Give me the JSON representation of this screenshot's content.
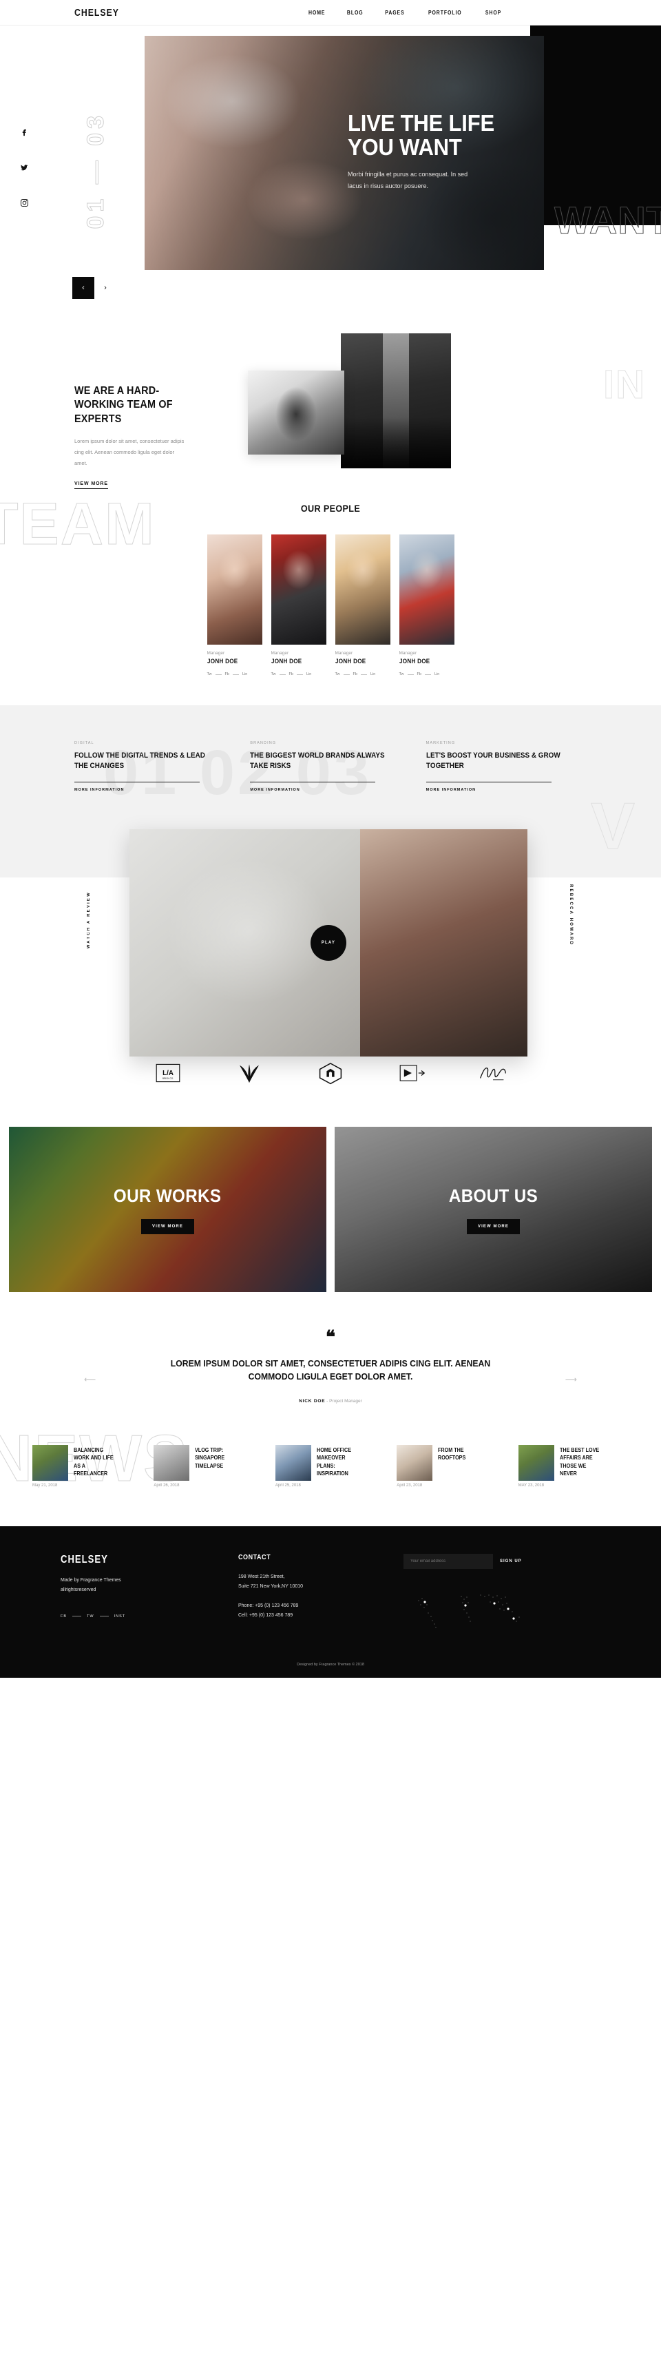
{
  "header": {
    "brand": "CHELSEY",
    "nav": [
      {
        "label": "HOME"
      },
      {
        "label": "BLOG"
      },
      {
        "label": "PAGES"
      },
      {
        "label": "PORTFOLIO"
      },
      {
        "label": "SHOP"
      }
    ]
  },
  "hero": {
    "counter": "01 — 03",
    "title_line1": "LIVE THE LIFE",
    "title_line2": "YOU WANT",
    "subtitle": "Morbi fringilla et purus ac consequat. In sed lacus in risus auctor posuere.",
    "outline_word": "WANT",
    "prev_label": "‹",
    "next_label": "›",
    "socials": [
      "facebook-icon",
      "twitter-icon",
      "instagram-icon"
    ]
  },
  "about": {
    "heading": "WE ARE A HARD-WORKING TEAM OF EXPERTS",
    "paragraph": "Lorem ipsum dolor sit amet, consectetuer adipis cing elit. Aenean commodo ligula eget dolor amet.",
    "link": "VIEW MORE",
    "outline_word": "IN"
  },
  "team": {
    "outline_word": "TEAM",
    "title": "OUR PEOPLE",
    "members": [
      {
        "role": "Manager",
        "name": "JONH DOE",
        "links": [
          "Tw",
          "Fb",
          "Lin"
        ]
      },
      {
        "role": "Manager",
        "name": "JONH DOE",
        "links": [
          "Tw",
          "Fb",
          "Lin"
        ]
      },
      {
        "role": "Manager",
        "name": "JONH DOE",
        "links": [
          "Tw",
          "Fb",
          "Lin"
        ]
      },
      {
        "role": "Manager",
        "name": "JONH DOE",
        "links": [
          "Tw",
          "Fb",
          "Lin"
        ]
      }
    ]
  },
  "services": {
    "ghost_word": "01 02 03",
    "items": [
      {
        "tag": "DIGITAL",
        "heading": "FOLLOW THE DIGITAL TRENDS & LEAD THE CHANGES",
        "more": "MORE INFORMATION"
      },
      {
        "tag": "BRANDING",
        "heading": "THE BIGGEST WORLD BRANDS ALWAYS TAKE RISKS",
        "more": "MORE INFORMATION"
      },
      {
        "tag": "MARKETING",
        "heading": "LET'S BOOST YOUR BUSINESS & GROW TOGETHER",
        "more": "MORE INFORMATION"
      }
    ]
  },
  "video": {
    "left_label": "WATCH A REVIEW",
    "right_label": "REBECCA HOWARD",
    "play_label": "PLAY",
    "big_letter": "V"
  },
  "logos": [
    {
      "name": "la-brick-logo",
      "text": "L/A"
    },
    {
      "name": "palm-leaf-logo",
      "text": ""
    },
    {
      "name": "hexagon-badge-logo",
      "text": ""
    },
    {
      "name": "flag-arrow-logo",
      "text": ""
    },
    {
      "name": "signature-script-logo",
      "text": ""
    }
  ],
  "cards": [
    {
      "title": "OUR WORKS",
      "button": "VIEW MORE"
    },
    {
      "title": "ABOUT US",
      "button": "VIEW MORE"
    }
  ],
  "testimonial": {
    "quote_mark": "❝",
    "text": "LOREM IPSUM DOLOR SIT AMET, CONSECTETUER ADIPIS CING ELIT. AENEAN COMMODO LIGULA EGET DOLOR AMET.",
    "author": "NICK DOE",
    "author_role": " - Project Manager",
    "prev": "⟵",
    "next": "⟶"
  },
  "news": {
    "ghost_word": "NEWS",
    "items": [
      {
        "date": "May 21, 2018",
        "title": "BALANCING WORK AND LIFE AS A FREELANCER"
      },
      {
        "date": "April 26, 2018",
        "title": "VLOG TRIP: SINGAPORE TIMELAPSE"
      },
      {
        "date": "April 25, 2018",
        "title": "HOME OFFICE MAKEOVER PLANS: INSPIRATION"
      },
      {
        "date": "April 23, 2018",
        "title": "FROM THE ROOFTOPS"
      },
      {
        "date": "MAY 23, 2018",
        "title": "THE BEST LOVE AFFAIRS ARE THOSE WE NEVER"
      }
    ]
  },
  "footer": {
    "brand": "CHELSEY",
    "made_line1": "Made by Fragrance Themes",
    "made_line2": "allrightsreserved",
    "socials": [
      "FB",
      "TW",
      "INST"
    ],
    "contact_heading": "CONTACT",
    "address_line1": "198 West 21th Street,",
    "address_line2": "Suite 721 New York,NY 10010",
    "phone": "Phone: +95 (0) 123 456 789",
    "cell": "Cell: +95 (0) 123 456 789",
    "subscribe_placeholder": "Your email address",
    "subscribe_button": "SIGN UP",
    "bottom": "Designed by Fragrance Themes © 2018"
  }
}
